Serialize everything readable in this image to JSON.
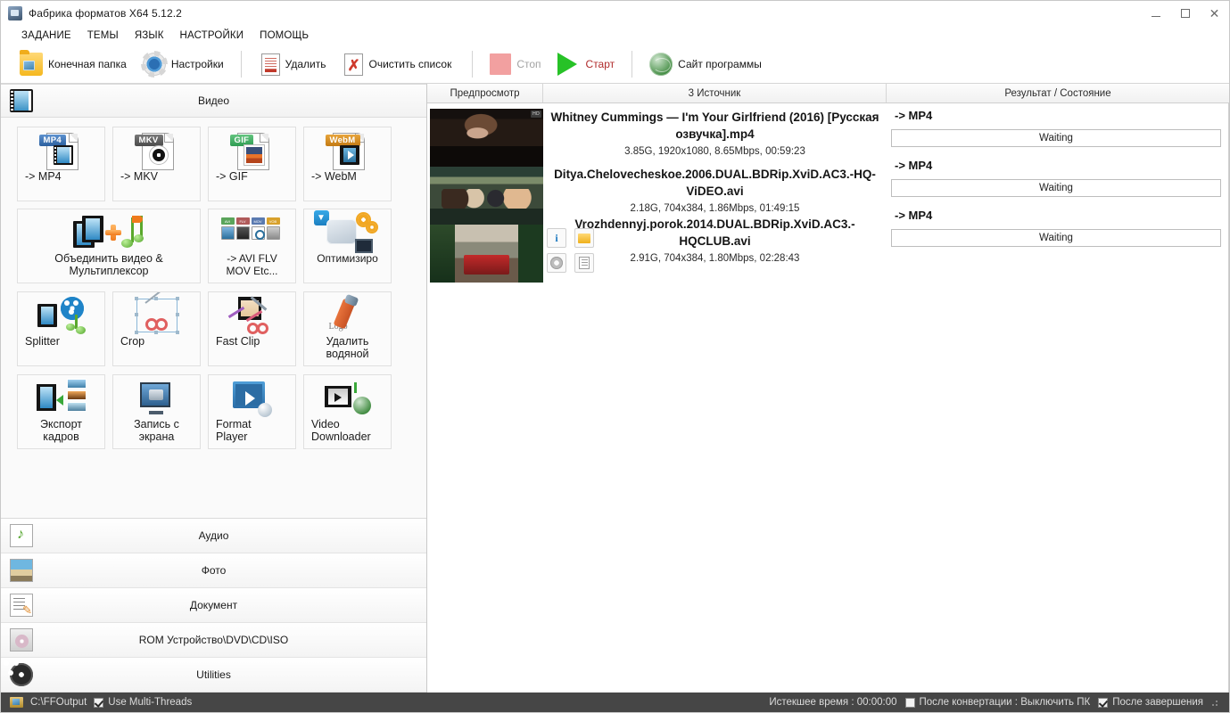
{
  "window": {
    "title": "Фабрика форматов X64 5.12.2",
    "app_icon": "app-icon",
    "minimize": "−",
    "maximize": "□",
    "close": "✕"
  },
  "menu": {
    "items": [
      {
        "label": "ЗАДАНИЕ"
      },
      {
        "label": "ТЕМЫ"
      },
      {
        "label": "ЯЗЫК"
      },
      {
        "label": "НАСТРОЙКИ"
      },
      {
        "label": "ПОМОЩЬ"
      }
    ]
  },
  "toolbar": {
    "output_folder": "Конечная папка",
    "settings": "Настройки",
    "delete": "Удалить",
    "clear_list": "Очистить список",
    "stop": "Стоп",
    "start": "Старт",
    "website": "Сайт программы"
  },
  "left_panel": {
    "active_category": "Видео",
    "tiles": [
      {
        "label": "-> MP4",
        "icon": "file-mp4-icon",
        "badge": "MP4"
      },
      {
        "label": "-> MKV",
        "icon": "file-mkv-icon",
        "badge": "MKV"
      },
      {
        "label": "-> GIF",
        "icon": "file-gif-icon",
        "badge": "GIF"
      },
      {
        "label": "-> WebM",
        "icon": "file-webm-icon",
        "badge": "WebM"
      },
      {
        "label": "Объединить видео &\nМультиплексор",
        "icon": "merge-video-icon"
      },
      {
        "label": "-> AVI FLV\nMOV Etc...",
        "icon": "multi-format-icon"
      },
      {
        "label": "Оптимизиро",
        "icon": "optimizer-icon"
      },
      {
        "label": "Splitter",
        "icon": "splitter-icon"
      },
      {
        "label": "Crop",
        "icon": "crop-icon"
      },
      {
        "label": "Fast Clip",
        "icon": "fast-clip-icon"
      },
      {
        "label": "Удалить\nводяной",
        "icon": "watermark-eraser-icon"
      },
      {
        "label": "Экспорт\nкадров",
        "icon": "export-frames-icon"
      },
      {
        "label": "Запись с\nэкрана",
        "icon": "screen-record-icon"
      },
      {
        "label": "Format\nPlayer",
        "icon": "format-player-icon"
      },
      {
        "label": "Video\nDownloader",
        "icon": "video-downloader-icon"
      }
    ],
    "categories": [
      {
        "label": "Аудио",
        "icon": "audio-icon"
      },
      {
        "label": "Фото",
        "icon": "photo-icon"
      },
      {
        "label": "Документ",
        "icon": "document-icon"
      },
      {
        "label": "ROM Устройство\\DVD\\CD\\ISO",
        "icon": "rom-icon"
      },
      {
        "label": "Utilities",
        "icon": "utilities-icon"
      }
    ]
  },
  "task_list": {
    "headers": {
      "preview": "Предпросмотр",
      "source": "3 Источник",
      "result": "Результат / Состояние"
    },
    "rows": [
      {
        "title": "Whitney Cummings — I'm Your Girlfriend (2016) [Русская озвучка].mp4",
        "meta": "3.85G, 1920x1080, 8.65Mbps, 00:59:23",
        "output_format": "-> MP4",
        "status": "Waiting",
        "thumb_badge": "HD"
      },
      {
        "title": "Ditya.Chelovecheskoe.2006.DUAL.BDRip.XviD.AC3.-HQ-ViDEO.avi",
        "meta": "2.18G, 704x384, 1.86Mbps, 01:49:15",
        "output_format": "-> MP4",
        "status": "Waiting",
        "thumb_badge": ""
      },
      {
        "title": "Vrozhdennyj.porok.2014.DUAL.BDRip.XviD.AC3.-HQCLUB.avi",
        "meta": "2.91G, 704x384, 1.80Mbps, 02:28:43",
        "output_format": "-> MP4",
        "status": "Waiting",
        "thumb_badge": ""
      }
    ],
    "mini_buttons": [
      {
        "icon": "info-icon",
        "label": "i"
      },
      {
        "icon": "open-folder-icon",
        "label": ""
      },
      {
        "icon": "gear-icon",
        "label": ""
      },
      {
        "icon": "file-properties-icon",
        "label": ""
      }
    ]
  },
  "statusbar": {
    "output_path": "C:\\FFOutput",
    "multithreads_label": "Use Multi-Threads",
    "multithreads_checked": true,
    "elapsed_label": "Истекшее время : 00:00:00",
    "after_convert_label": "После конвертации : Выключить ПК",
    "after_convert_checked": false,
    "after_finish_label": "После завершения",
    "after_finish_checked": true
  }
}
